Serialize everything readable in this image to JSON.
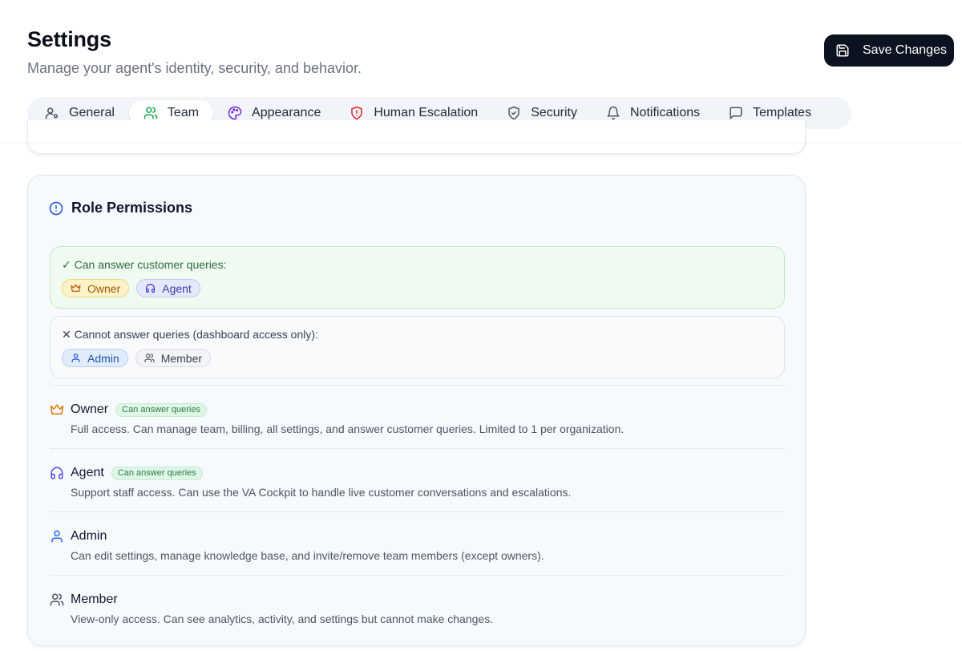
{
  "header": {
    "title": "Settings",
    "subtitle": "Manage your agent's identity, security, and behavior."
  },
  "save_button": {
    "label": "Save Changes",
    "icon": "save-icon"
  },
  "tabs": [
    {
      "label": "General",
      "icon": "user-settings-icon",
      "active": false
    },
    {
      "label": "Team",
      "icon": "users-icon",
      "active": true
    },
    {
      "label": "Appearance",
      "icon": "palette-icon",
      "active": false
    },
    {
      "label": "Human Escalation",
      "icon": "shield-alert-icon",
      "active": false
    },
    {
      "label": "Security",
      "icon": "shield-check-icon",
      "active": false
    },
    {
      "label": "Notifications",
      "icon": "bell-icon",
      "active": false
    },
    {
      "label": "Templates",
      "icon": "message-square-icon",
      "active": false
    }
  ],
  "role_permissions": {
    "title": "Role Permissions",
    "can_answer": {
      "label": "✓ Can answer customer queries:",
      "chips": [
        "Owner",
        "Agent"
      ]
    },
    "cannot_answer": {
      "label": "✕ Cannot answer queries (dashboard access only):",
      "chips": [
        "Admin",
        "Member"
      ]
    },
    "roles": [
      {
        "name": "Owner",
        "badge": "Can answer queries",
        "description": "Full access. Can manage team, billing, all settings, and answer customer queries. Limited to 1 per organization."
      },
      {
        "name": "Agent",
        "badge": "Can answer queries",
        "description": "Support staff access. Can use the VA Cockpit to handle live customer conversations and escalations."
      },
      {
        "name": "Admin",
        "badge": "",
        "description": "Can edit settings, manage knowledge base, and invite/remove team members (except owners)."
      },
      {
        "name": "Member",
        "badge": "",
        "description": "View-only access. Can see analytics, activity, and settings but cannot make changes."
      }
    ]
  },
  "colors": {
    "primary_button": "#0b1220",
    "owner": "#d97706",
    "agent": "#4f46e5",
    "admin": "#2563eb",
    "success": "#16a34a",
    "danger": "#dc2626"
  }
}
